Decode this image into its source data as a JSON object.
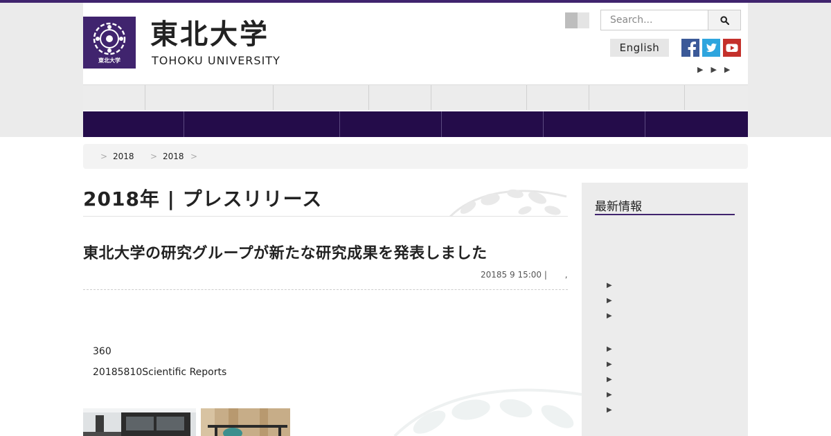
{
  "header": {
    "logo_jp": "東北大学",
    "logo_en": "TOHOKU UNIVERSITY",
    "logo_mark_text": "東北大学",
    "search": {
      "placeholder": "Search..."
    },
    "language_button": "English",
    "social": [
      "facebook-icon",
      "twitter-icon",
      "youtube-icon"
    ],
    "mini_arrows": "▶▶▶"
  },
  "util_nav": {
    "items": 8
  },
  "main_nav": {
    "items": 6
  },
  "breadcrumb": {
    "separator": ">",
    "items": [
      "2018",
      "2018"
    ]
  },
  "page": {
    "title": "2018年 | プレスリリース"
  },
  "article": {
    "title": "東北大学の研究グループが新たな研究成果を発表しました",
    "meta_date": "20185 9 15:00 |",
    "meta_tail": ",",
    "body": [
      "360",
      "20185810Scientific Reports"
    ]
  },
  "sidebar": {
    "title": "最新情報",
    "arrow": "▶"
  },
  "colors": {
    "brand_purple": "#40246e",
    "nav_dark": "#240c4a"
  }
}
